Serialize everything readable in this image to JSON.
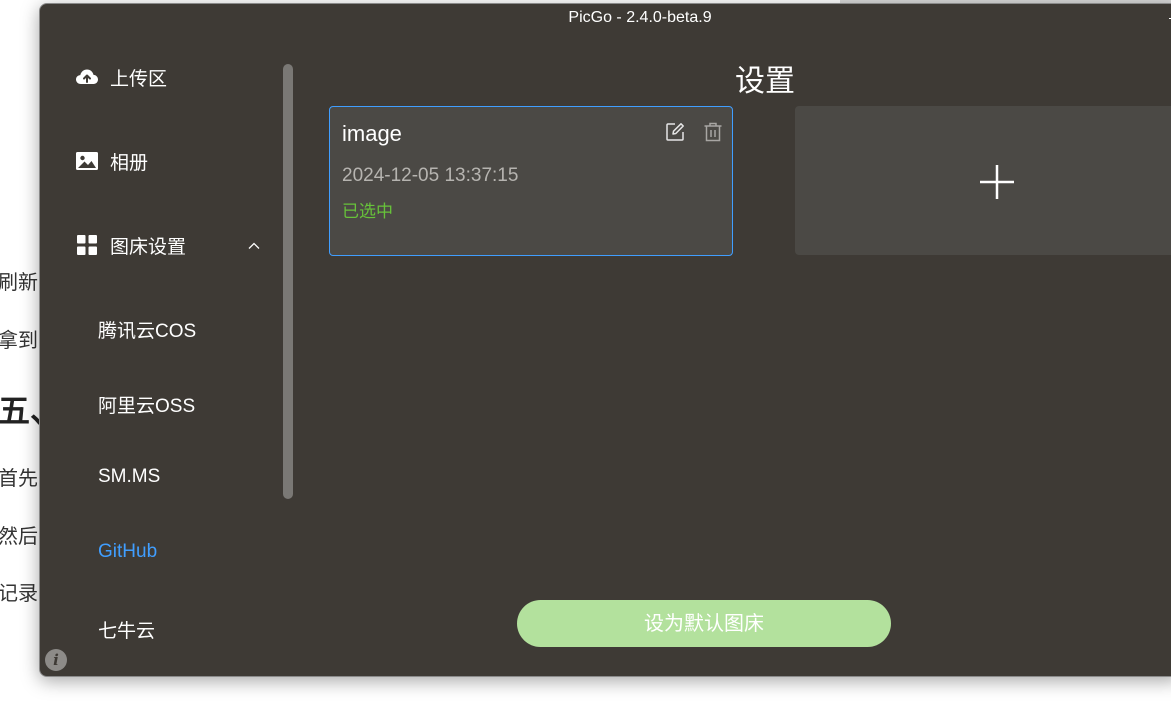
{
  "window": {
    "title": "PicGo - 2.4.0-beta.9"
  },
  "background_doc": {
    "lines": [
      "刷新",
      "拿到",
      "五、",
      "首先",
      "然后",
      "记录"
    ]
  },
  "sidebar": {
    "upload": {
      "label": "上传区",
      "icon": "cloud-upload-icon"
    },
    "gallery": {
      "label": "相册",
      "icon": "image-icon"
    },
    "picbed_settings": {
      "label": "图床设置",
      "icon": "grid-icon",
      "expanded": true
    },
    "picbeds": [
      {
        "label": "腾讯云COS",
        "active": false
      },
      {
        "label": "阿里云OSS",
        "active": false
      },
      {
        "label": "SM.MS",
        "active": false
      },
      {
        "label": "GitHub",
        "active": true
      },
      {
        "label": "七牛云",
        "active": false
      }
    ]
  },
  "main": {
    "title": "设置",
    "config_card": {
      "name": "image",
      "date": "2024-12-05 13:37:15",
      "status": "已选中"
    },
    "default_button_label": "设为默认图床"
  },
  "colors": {
    "window_bg": "#3e3a35",
    "card_bg": "#4b4945",
    "accent": "#409eff",
    "selected_status": "#67c23a",
    "default_button_bg": "#b3e19d"
  }
}
